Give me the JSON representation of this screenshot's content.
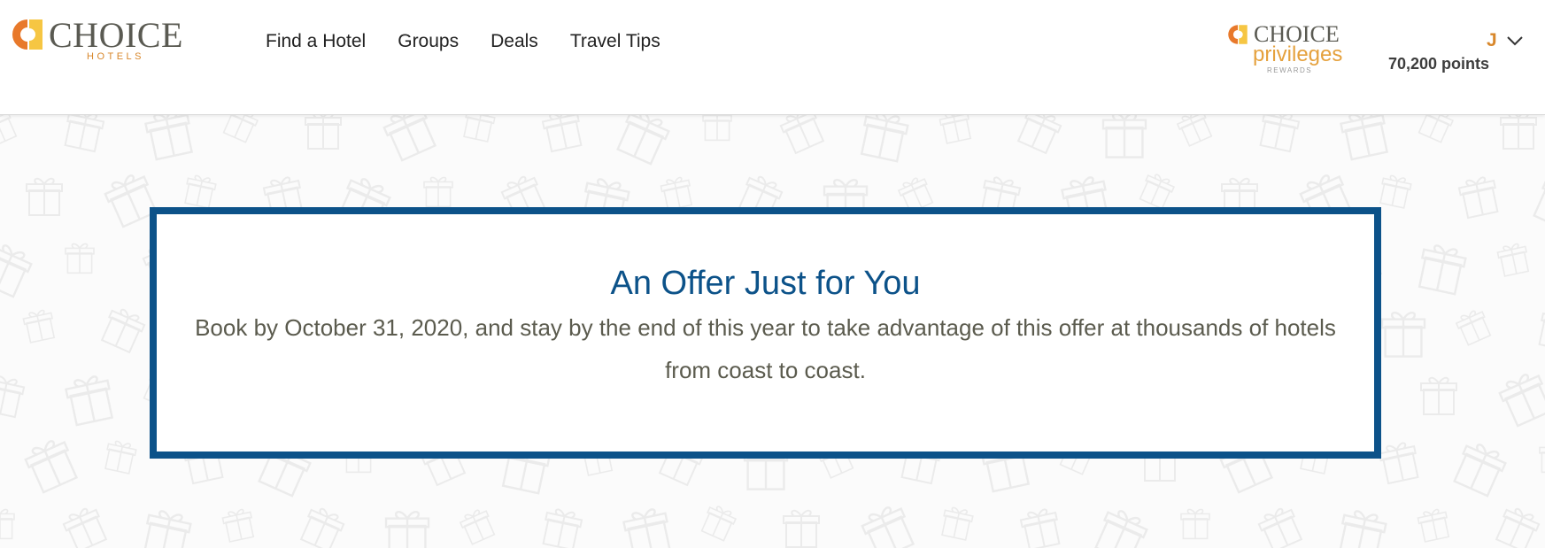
{
  "brand": {
    "logo_word": "CHOICE",
    "logo_sub": "HOTELS",
    "orange": "#e8792b",
    "yellow": "#f6c643"
  },
  "nav": {
    "items": [
      {
        "label": "Find a Hotel"
      },
      {
        "label": "Groups"
      },
      {
        "label": "Deals"
      },
      {
        "label": "Travel Tips"
      }
    ]
  },
  "rewards_logo": {
    "word": "CHOICE",
    "privileges": "privileges",
    "rewards": "REWARDS"
  },
  "account": {
    "initial": "J",
    "points": "70,200 points",
    "menu_icon": "chevron-down-icon"
  },
  "offer": {
    "title": "An Offer Just for You",
    "body": "Book by October 31, 2020, and stay by the end of this year to take advantage of this offer at thousands of hotels from coast to coast.",
    "border_color": "#0c5289"
  },
  "background": {
    "pattern_icon": "gift-icon"
  }
}
